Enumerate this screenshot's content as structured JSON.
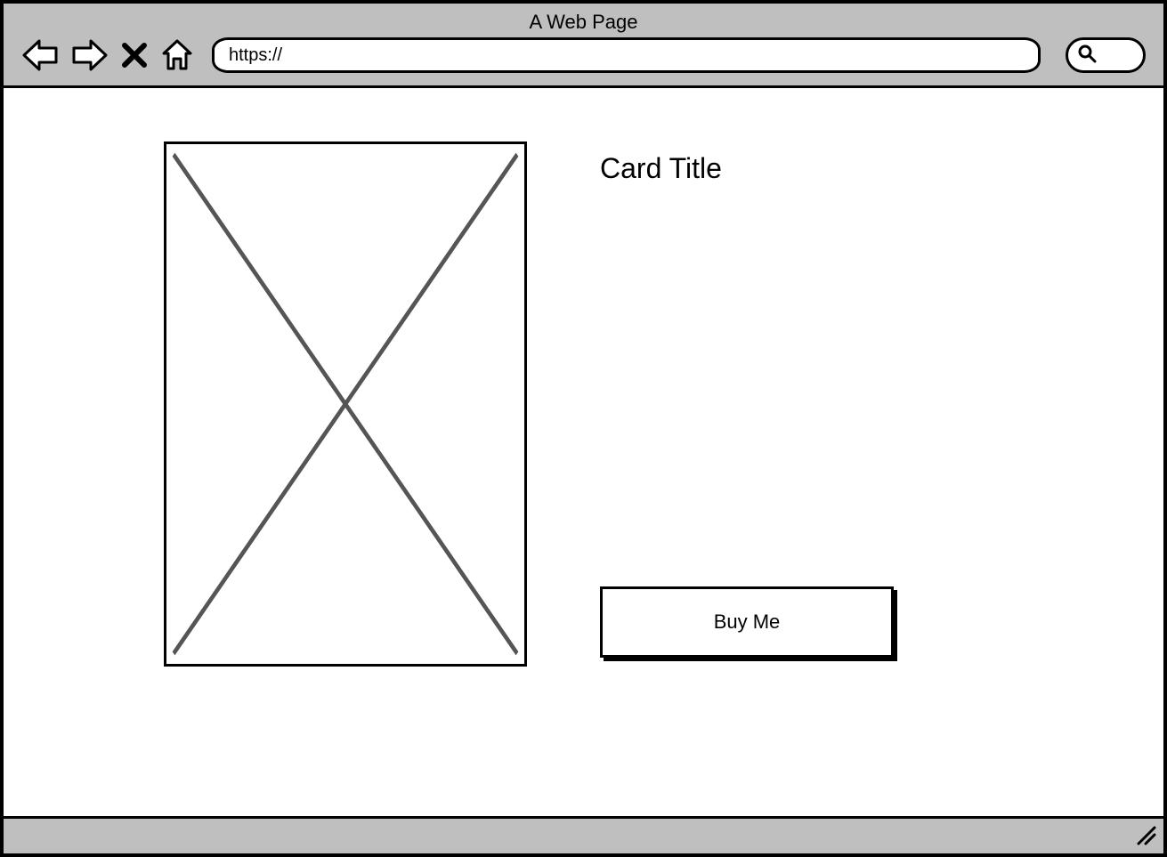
{
  "browser": {
    "title": "A Web Page",
    "address_value": "https://",
    "icons": {
      "back": "back-arrow-icon",
      "forward": "forward-arrow-icon",
      "stop": "stop-x-icon",
      "home": "home-icon",
      "search": "search-icon"
    }
  },
  "card": {
    "title": "Card Title",
    "buy_button_label": "Buy Me",
    "image_alt": "placeholder-image"
  }
}
